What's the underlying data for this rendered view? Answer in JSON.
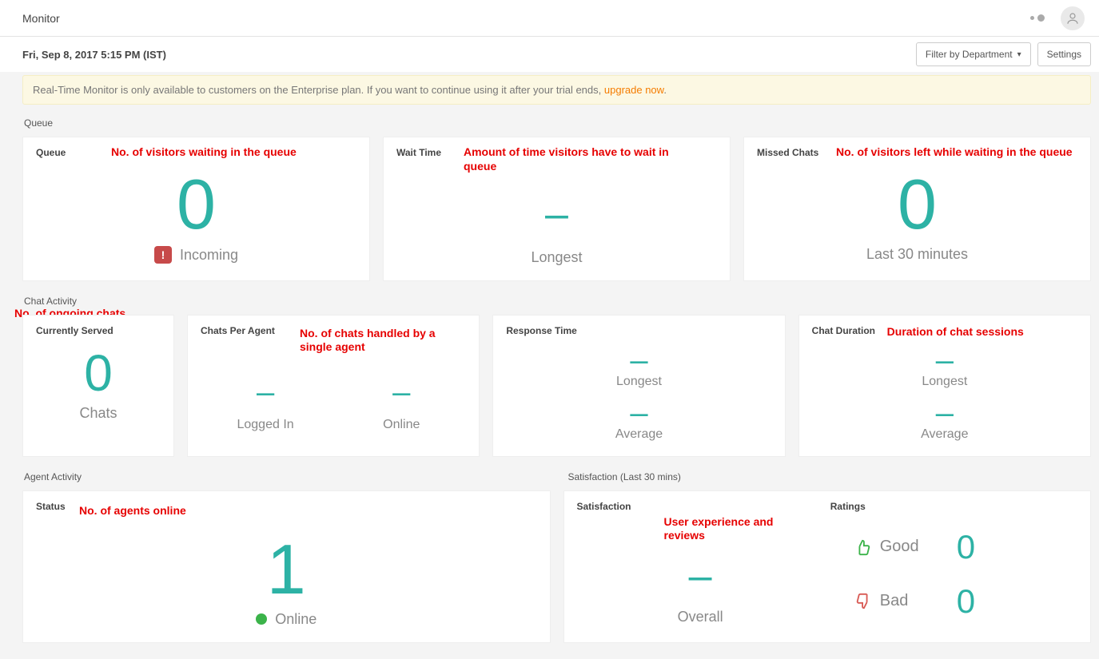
{
  "topbar": {
    "title": "Monitor"
  },
  "timestamp": "Fri, Sep 8, 2017 5:15 PM (IST)",
  "buttons": {
    "filter": "Filter by Department",
    "settings": "Settings"
  },
  "banner": {
    "text": "Real-Time Monitor is only available to customers on the Enterprise plan. If you want to continue using it after your trial ends, ",
    "link": "upgrade now"
  },
  "sections": {
    "queue": "Queue",
    "chat_activity": "Chat Activity",
    "agent_activity": "Agent Activity",
    "satisfaction": "Satisfaction (Last 30 mins)"
  },
  "queue": {
    "queue": {
      "title": "Queue",
      "value": "0",
      "label": "Incoming",
      "annot": "No. of visitors waiting in the queue"
    },
    "wait": {
      "title": "Wait Time",
      "value": "–",
      "label": "Longest",
      "annot": "Amount of time visitors have to wait in queue"
    },
    "missed": {
      "title": "Missed Chats",
      "value": "0",
      "label": "Last 30 minutes",
      "annot": "No. of visitors left while waiting in the queue"
    }
  },
  "chat": {
    "served": {
      "title": "Currently Served",
      "value": "0",
      "label": "Chats",
      "annot": "No. of ongoing chats"
    },
    "per_agent": {
      "title": "Chats Per Agent",
      "logged": {
        "value": "–",
        "label": "Logged In"
      },
      "online": {
        "value": "–",
        "label": "Online"
      },
      "annot": "No. of chats handled by a single agent"
    },
    "response": {
      "title": "Response Time",
      "longest": {
        "value": "–",
        "label": "Longest"
      },
      "average": {
        "value": "–",
        "label": "Average"
      }
    },
    "duration": {
      "title": "Chat Duration",
      "longest": {
        "value": "–",
        "label": "Longest"
      },
      "average": {
        "value": "–",
        "label": "Average"
      },
      "annot": "Duration of chat sessions"
    }
  },
  "agent": {
    "status": {
      "title": "Status",
      "value": "1",
      "label": "Online",
      "annot": "No. of agents online"
    }
  },
  "satisfaction": {
    "title": "Satisfaction",
    "overall": {
      "value": "–",
      "label": "Overall"
    },
    "ratings_title": "Ratings",
    "good": {
      "label": "Good",
      "value": "0"
    },
    "bad": {
      "label": "Bad",
      "value": "0"
    },
    "annot": "User experience and reviews"
  }
}
